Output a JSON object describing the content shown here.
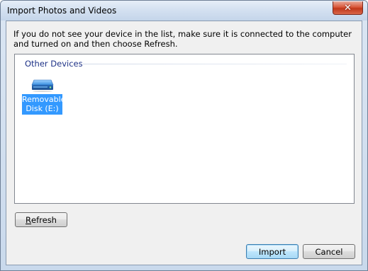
{
  "window": {
    "title": "Import Photos and Videos",
    "close_glyph": "✕"
  },
  "instructions": "If you do not see your device in the list, make sure it is connected to the computer and turned on and then choose Refresh.",
  "device_list": {
    "group_label": "Other Devices",
    "items": [
      {
        "label": "Removable Disk (E:)",
        "icon": "removable-drive-icon",
        "selected": true
      }
    ]
  },
  "buttons": {
    "refresh_underlined": "R",
    "refresh_rest": "efresh",
    "import_label": "Import",
    "cancel_label": "Cancel"
  },
  "colors": {
    "selection": "#3399ff",
    "group_label": "#1e3287",
    "close_button": "#c0381a"
  }
}
